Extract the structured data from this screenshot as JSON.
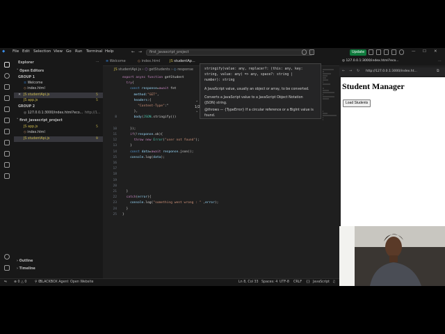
{
  "menu": [
    "File",
    "Edit",
    "Selection",
    "View",
    "Go",
    "Run",
    "Terminal",
    "Help"
  ],
  "command_center": "first_javascript_project",
  "update_label": "Update",
  "sidebar": {
    "title": "Explorer",
    "open_editors": "Open Editors",
    "group1": "GROUP 1",
    "group1_items": [
      {
        "name": "Welcome",
        "type": "other"
      },
      {
        "name": "index.html",
        "type": "html"
      },
      {
        "name": "studentApi.js",
        "type": "js",
        "badge": "5"
      },
      {
        "name": "app.js",
        "type": "js",
        "badge": "5"
      }
    ],
    "group2": "GROUP 2",
    "group2_items": [
      {
        "name": "127.0.0.1:3000/index.html?eco...",
        "extra": "http://1..."
      }
    ],
    "project": "first_javascript_project",
    "project_items": [
      {
        "name": "app.js",
        "type": "js",
        "badge": "5"
      },
      {
        "name": "index.html",
        "type": "html"
      },
      {
        "name": "studentApi.js",
        "type": "js",
        "badge": "9"
      }
    ],
    "outline": "Outline",
    "timeline": "Timeline"
  },
  "editor": {
    "tabs": [
      "Welcome",
      "index.html",
      "studentAp..."
    ],
    "breadcrumb": [
      "studentApi.js",
      "getStudents",
      "response"
    ],
    "lines": [
      {
        "n": "",
        "code": "export async function getStudent"
      },
      {
        "n": "",
        "code": "  try{"
      },
      {
        "n": "",
        "code": "    const response=await fet"
      },
      {
        "n": "",
        "code": "      method:\"GET\","
      },
      {
        "n": "",
        "code": "      headers:{"
      },
      {
        "n": "",
        "code": "        \"Content-Type\":\""
      },
      {
        "n": "",
        "code": "      },"
      },
      {
        "n": "8",
        "code": "      body(JSON.stringify())"
      },
      {
        "n": "",
        "code": ""
      },
      {
        "n": "10",
        "code": "    });"
      },
      {
        "n": "11",
        "code": "    if(!response.ok){"
      },
      {
        "n": "12",
        "code": "      throw new Error(\"user not found\");"
      },
      {
        "n": "13",
        "code": "    }"
      },
      {
        "n": "14",
        "code": "    const data=await response.json();"
      },
      {
        "n": "15",
        "code": "    console.log(data);"
      },
      {
        "n": "16",
        "code": ""
      },
      {
        "n": "17",
        "code": ""
      },
      {
        "n": "18",
        "code": ""
      },
      {
        "n": "19",
        "code": ""
      },
      {
        "n": "20",
        "code": ""
      },
      {
        "n": "21",
        "code": "  }"
      },
      {
        "n": "22",
        "code": "  catch(error){"
      },
      {
        "n": "23",
        "code": "    console.log(\"something went wrong : \" ,error);"
      },
      {
        "n": "24",
        "code": "  }"
      },
      {
        "n": "25",
        "code": "}"
      }
    ],
    "hover": {
      "signature1": "stringify(value: any, replacer?: (this: any, key:",
      "signature2": "string, value: any) => any, space?: string |",
      "signature3": "number): string",
      "overload": "1/2",
      "desc1": "A JavaScript value, usually an object or array, to be converted.",
      "desc2": "Converts a JavaScript value to a JavaScript Object Notation",
      "desc3": "(JSON) string.",
      "throws1": "@throws — {TypeError} If a circular reference or a BigInt value is",
      "throws2": "found."
    }
  },
  "browser": {
    "tab": "127.0.0.1:3000/index.html?eco...",
    "url": "http://127.0.0.1:3000/index.ht...",
    "page_heading": "Student Manager",
    "button": "Load Students"
  },
  "status": {
    "errors": "0",
    "warnings": "0",
    "agent": "BLACKBOX Agent",
    "open_website": "Open Website",
    "position": "Ln 8, Col 33",
    "spaces": "Spaces: 4",
    "encoding": "UTF-8",
    "eol": "CRLF",
    "language": "JavaScript"
  }
}
